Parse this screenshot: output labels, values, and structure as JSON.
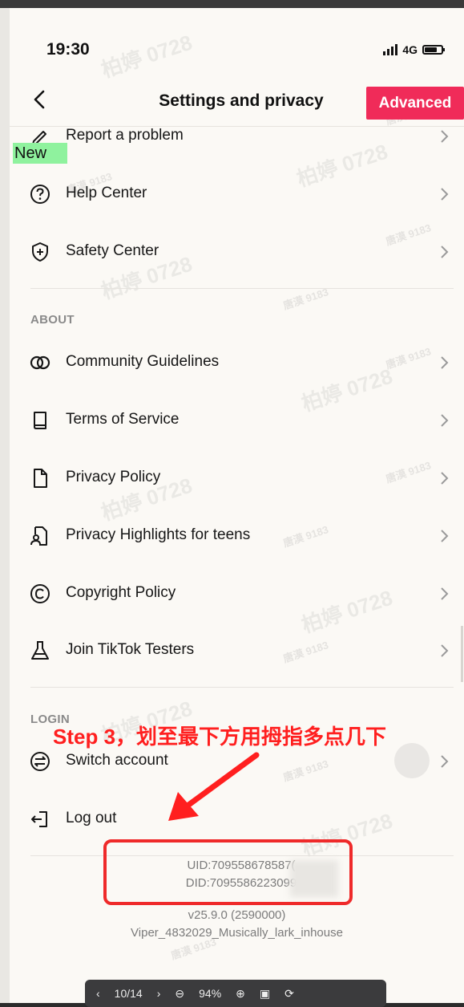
{
  "status_bar": {
    "time": "19:30",
    "network": "4G"
  },
  "header": {
    "title": "Settings and privacy",
    "advanced_label": "Advanced"
  },
  "new_badge": "New",
  "support_items": [
    {
      "label": "Report a problem",
      "icon": "pencil-icon"
    },
    {
      "label": "Help Center",
      "icon": "question-circle-icon"
    },
    {
      "label": "Safety Center",
      "icon": "shield-plus-icon"
    }
  ],
  "about": {
    "title": "ABOUT",
    "items": [
      {
        "label": "Community Guidelines",
        "icon": "rings-icon"
      },
      {
        "label": "Terms of Service",
        "icon": "book-icon"
      },
      {
        "label": "Privacy Policy",
        "icon": "document-icon"
      },
      {
        "label": "Privacy Highlights for teens",
        "icon": "document-person-icon"
      },
      {
        "label": "Copyright Policy",
        "icon": "copyright-icon"
      },
      {
        "label": "Join TikTok Testers",
        "icon": "flask-icon"
      }
    ]
  },
  "login": {
    "title": "LOGIN",
    "switch_account": "Switch account",
    "log_out": "Log out"
  },
  "ids": {
    "uid": "UID:709558678587(",
    "did": "DID:7095586223099"
  },
  "version": {
    "line1": "v25.9.0 (2590000)",
    "line2": "Viper_4832029_Musically_lark_inhouse"
  },
  "annotation": "Step 3，划至最下方用拇指多点几下",
  "watermarks": {
    "big": "柏婷 0728",
    "small": "唐漠 9183"
  },
  "viewer": {
    "page": "10/14",
    "zoom": "94%"
  },
  "colors": {
    "accent": "#f02b59",
    "annotation": "#ff1f1f",
    "badge": "#8ff29e"
  }
}
